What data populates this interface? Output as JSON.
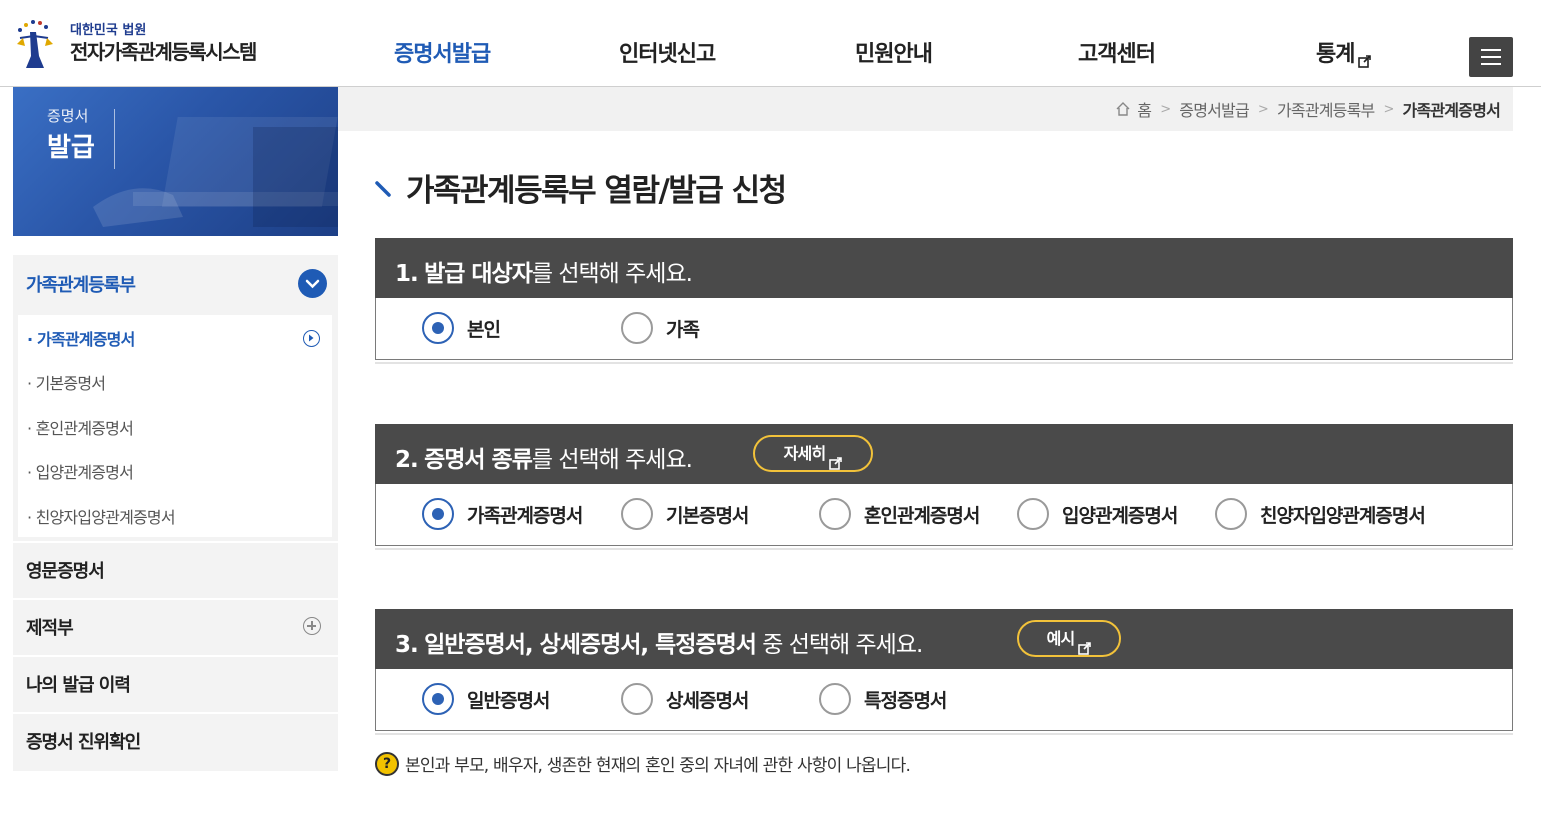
{
  "header": {
    "logo_top": "대한민국 법원",
    "logo_main": "전자가족관계등록시스템",
    "nav": [
      {
        "label": "증명서발급"
      },
      {
        "label": "인터넷신고"
      },
      {
        "label": "민원안내"
      },
      {
        "label": "고객센터"
      },
      {
        "label": "통계"
      }
    ]
  },
  "banner": {
    "line1": "증명서",
    "line2": "발급"
  },
  "sidebar": {
    "head": "가족관계등록부",
    "sub_items": [
      {
        "label": "· 가족관계증명서"
      },
      {
        "label": "· 기본증명서"
      },
      {
        "label": "· 혼인관계증명서"
      },
      {
        "label": "· 입양관계증명서"
      },
      {
        "label": "· 친양자입양관계증명서"
      }
    ],
    "items": [
      {
        "label": "영문증명서"
      },
      {
        "label": "제적부"
      },
      {
        "label": "나의 발급 이력"
      },
      {
        "label": "증명서 진위확인"
      }
    ]
  },
  "breadcrumb": {
    "home": "홈",
    "items": [
      "증명서발급",
      "가족관계등록부"
    ],
    "current": "가족관계증명서"
  },
  "page_title": "가족관계등록부 열람/발급 신청",
  "sections": [
    {
      "num": "1.",
      "bold": "발급 대상자",
      "rest": "를 선택해 주세요.",
      "options": [
        {
          "label": "본인"
        },
        {
          "label": "가족"
        }
      ]
    },
    {
      "num": "2.",
      "bold": "증명서 종류",
      "rest": "를 선택해 주세요.",
      "button": "자세히",
      "options": [
        {
          "label": "가족관계증명서"
        },
        {
          "label": "기본증명서"
        },
        {
          "label": "혼인관계증명서"
        },
        {
          "label": "입양관계증명서"
        },
        {
          "label": "친양자입양관계증명서"
        }
      ]
    },
    {
      "num": "3.",
      "bold": "일반증명서, 상세증명서, 특정증명서",
      "rest": " 중 선택해 주세요.",
      "button": "예시",
      "options": [
        {
          "label": "일반증명서"
        },
        {
          "label": "상세증명서"
        },
        {
          "label": "특정증명서"
        }
      ]
    }
  ],
  "notice": "본인과 부모, 배우자, 생존한 현재의 혼인 중의 자녀에 관한 사항이 나옵니다.",
  "colors": {
    "accent": "#1f5bb5",
    "section_bg": "#4a4a4a",
    "pill_border": "#f2c23a"
  }
}
